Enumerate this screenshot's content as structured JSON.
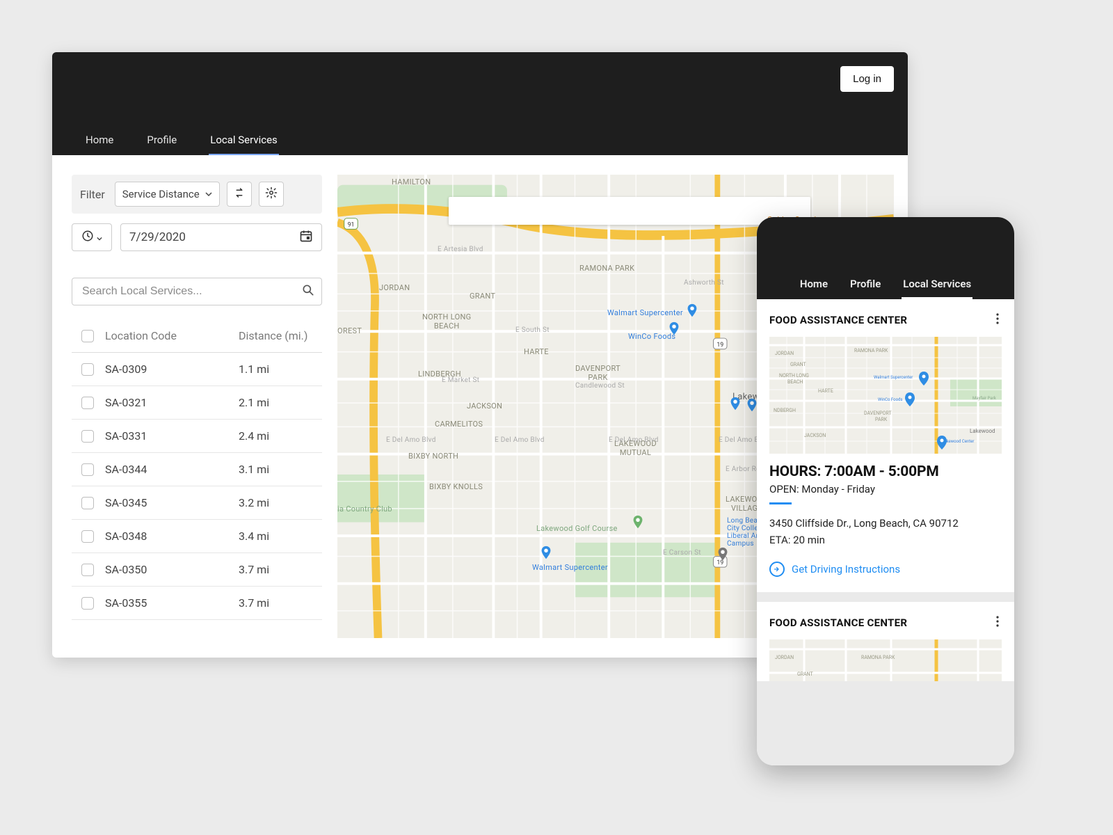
{
  "desktop": {
    "login": "Log in",
    "nav": {
      "home": "Home",
      "profile": "Profile",
      "local": "Local Services"
    },
    "filter": {
      "label": "Filter",
      "select": "Service Distance",
      "date": "7/29/2020",
      "search_placeholder": "Search Local Services..."
    },
    "table": {
      "col_code": "Location Code",
      "col_dist": "Distance (mi.)",
      "rows": [
        {
          "code": "SA-0309",
          "dist": "1.1 mi"
        },
        {
          "code": "SA-0321",
          "dist": "2.1 mi"
        },
        {
          "code": "SA-0331",
          "dist": "2.4 mi"
        },
        {
          "code": "SA-0344",
          "dist": "3.1 mi"
        },
        {
          "code": "SA-0345",
          "dist": "3.2 mi"
        },
        {
          "code": "SA-0348",
          "dist": "3.4 mi"
        },
        {
          "code": "SA-0350",
          "dist": "3.7 mi"
        },
        {
          "code": "SA-0355",
          "dist": "3.7 mi"
        }
      ]
    },
    "map": {
      "labels": {
        "hamilton": "HAMILTON",
        "jordan": "JORDAN",
        "grant": "GRANT",
        "ramona": "RAMONA PARK",
        "nlb": "NORTH LONG\nBEACH",
        "harte": "HARTE",
        "lindbergh": "LINDBERGH",
        "jackson": "JACKSON",
        "carmelitos": "CARMELITOS",
        "davenport": "DAVENPORT\nPARK",
        "bixby_north": "BIXBY NORTH",
        "bixby_knolls": "BIXBY KNOLLS",
        "lakewood_mutual": "LAKEWOOD\nMUTUAL",
        "lakewood_village": "LAKEWOOD\nVILLAGE",
        "lakewood": "Lakewood",
        "forest": "OREST",
        "country_club": "ia Country Club",
        "golf": "Lakewood Golf Course",
        "walmart": "Walmart Supercenter",
        "walmart2": "Walmart Supercenter",
        "winco": "WinCo Foods",
        "corral": "Golden Corral\nBuffet & Grill",
        "ashworth": "Ashworth St",
        "artesia": "E Artesia Blvd",
        "south": "E South St",
        "market": "E Market St",
        "delamo": "E Del Amo Blvd",
        "candlewood": "Candlewood St",
        "arbor": "E Arbor Rd",
        "carson": "E Carson St",
        "lbcc": "Long Beach\nCity College\nLiberal Arts\nCampus"
      }
    }
  },
  "mobile": {
    "nav": {
      "home": "Home",
      "profile": "Profile",
      "local": "Local Services"
    },
    "card1": {
      "title": "FOOD ASSISTANCE CENTER",
      "hours": "HOURS: 7:00AM - 5:00PM",
      "open": "OPEN: Monday - Friday",
      "address": "3450 Cliffside Dr., Long Beach, CA 90712",
      "eta": "ETA: 20 min",
      "drive": "Get Driving Instructions"
    },
    "card2": {
      "title": "FOOD ASSISTANCE CENTER"
    }
  }
}
